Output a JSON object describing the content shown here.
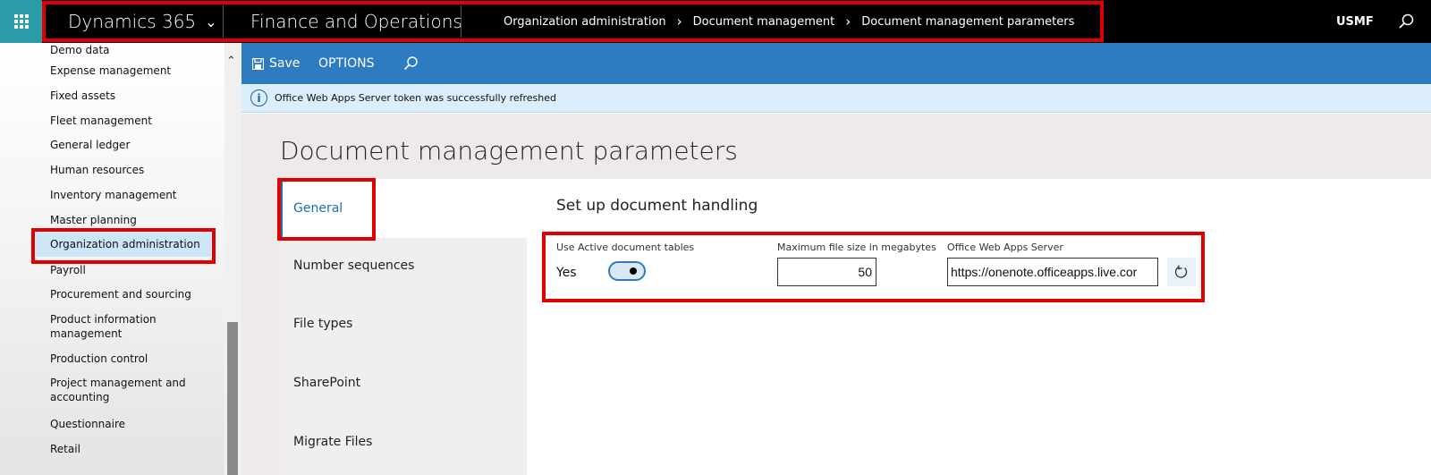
{
  "topbar": {
    "product": "Dynamics 365",
    "app_name": "Finance and Operations",
    "breadcrumb": [
      "Organization administration",
      "Document management",
      "Document management parameters"
    ],
    "company": "USMF"
  },
  "nav": {
    "items": [
      "Demo data",
      "Expense management",
      "Fixed assets",
      "Fleet management",
      "General ledger",
      "Human resources",
      "Inventory management",
      "Master planning",
      "Organization administration",
      "Payroll",
      "Procurement and sourcing",
      "Product information management",
      "Production control",
      "Project management and accounting",
      "Questionnaire",
      "Retail"
    ],
    "active": "Organization administration"
  },
  "command_bar": {
    "save": "Save",
    "options": "OPTIONS"
  },
  "message": "Office Web Apps Server token was successfully refreshed",
  "page_title": "Document management parameters",
  "tabs": [
    "General",
    "Number sequences",
    "File types",
    "SharePoint",
    "Migrate Files"
  ],
  "active_tab": "General",
  "section_title": "Set up document handling",
  "fields": {
    "active_tables": {
      "label": "Use Active document tables",
      "value": "Yes",
      "on": true
    },
    "max_size": {
      "label": "Maximum file size in megabytes",
      "value": "50"
    },
    "web_apps": {
      "label": "Office Web Apps Server",
      "value": "https://onenote.officeapps.live.cor"
    }
  },
  "colors": {
    "command_bar": "#2f7bbf",
    "highlight": "#e00000",
    "accent": "#1f6fb5",
    "waffle": "#2a9ba8"
  }
}
